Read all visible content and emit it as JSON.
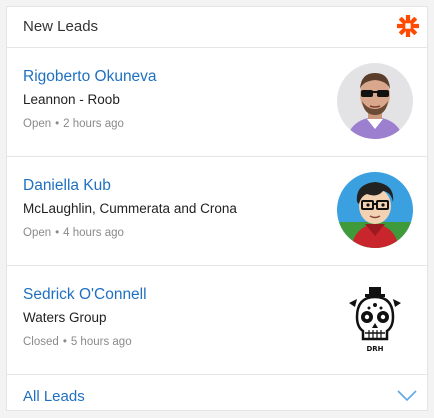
{
  "header": {
    "title": "New Leads",
    "logo_icon": "zapier-asterisk-icon",
    "logo_color": "#ff4a00"
  },
  "leads": [
    {
      "name": "Rigoberto Okuneva",
      "company": "Leannon - Roob",
      "status": "Open",
      "time": "2 hours ago",
      "avatar": "sunglasses-man-avatar"
    },
    {
      "name": "Daniella Kub",
      "company": "McLaughlin, Cummerata and Crona",
      "status": "Open",
      "time": "4 hours ago",
      "avatar": "cartoon-glasses-avatar"
    },
    {
      "name": "Sedrick O'Connell",
      "company": "Waters Group",
      "status": "Closed",
      "time": "5 hours ago",
      "avatar": "sugar-skull-avatar",
      "avatar_text": "DRH"
    }
  ],
  "footer": {
    "link_label": "All Leads",
    "expand_icon": "chevron-down-icon"
  },
  "colors": {
    "link": "#1f70c1",
    "meta": "#8a8a8a",
    "divider": "#e6e6e6"
  }
}
